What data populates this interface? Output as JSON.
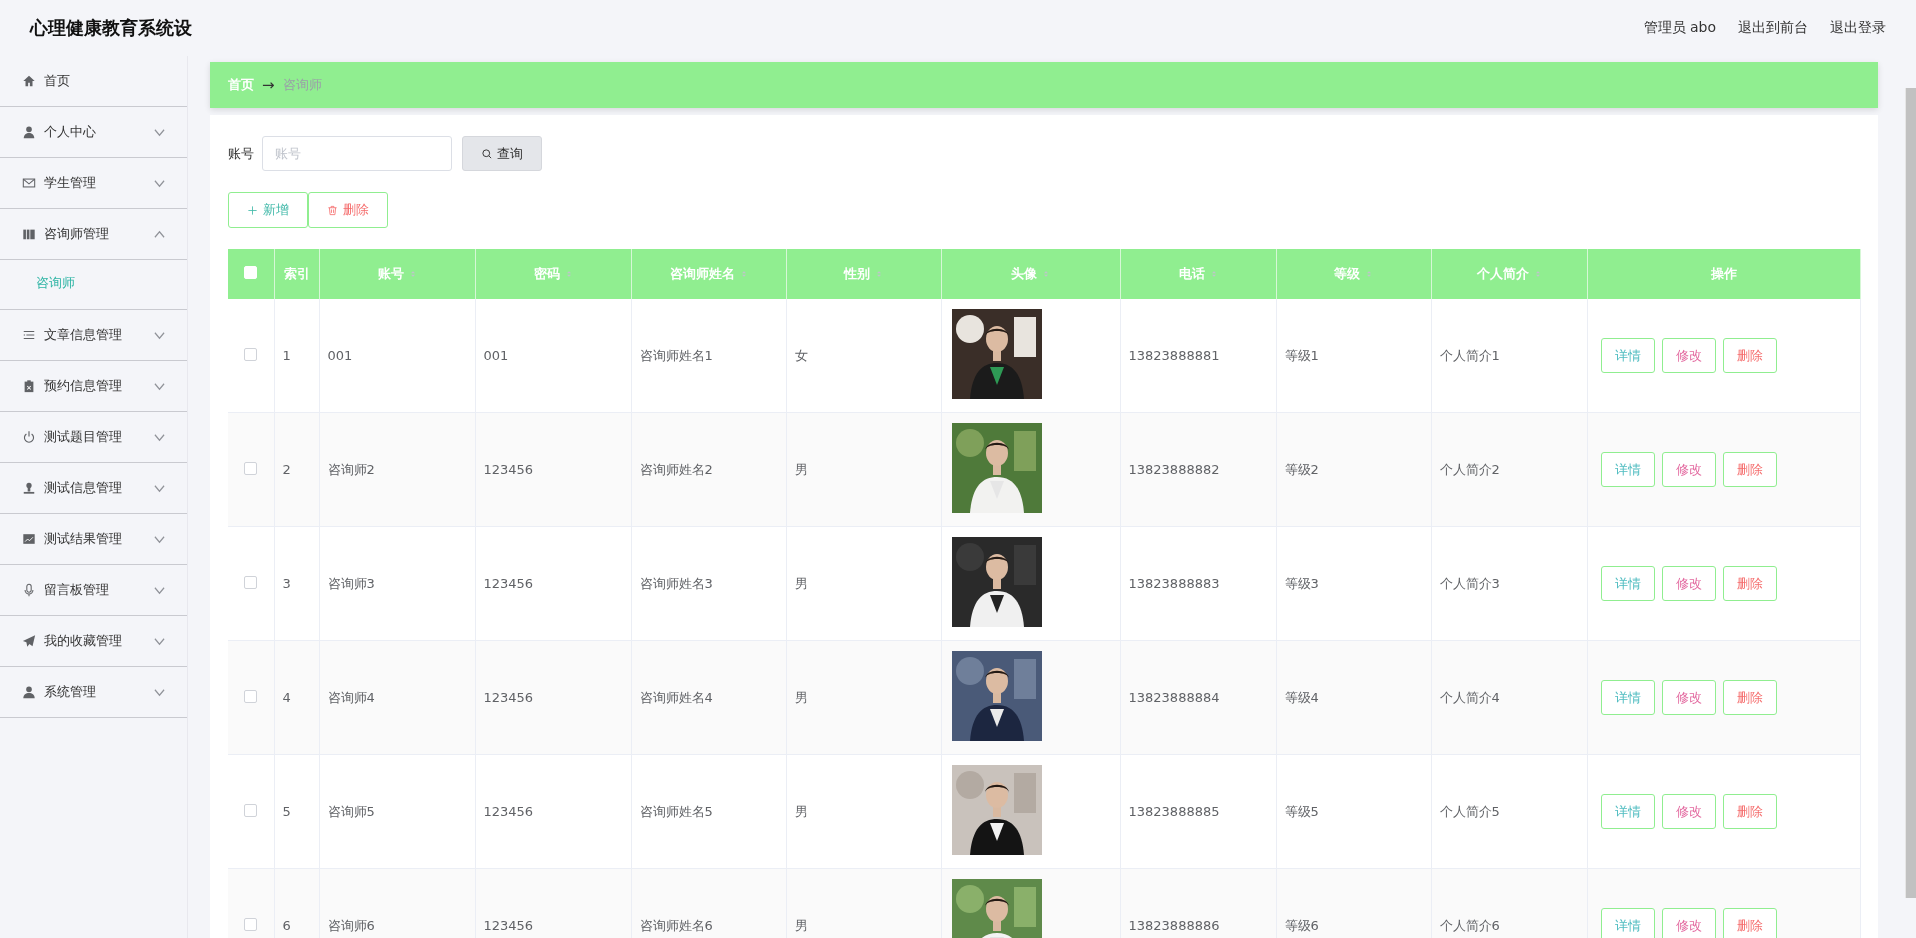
{
  "header": {
    "title": "心理健康教育系统设",
    "user": "管理员 abo",
    "links": [
      "退出到前台",
      "退出登录"
    ]
  },
  "sidebar": {
    "items": [
      {
        "label": "首页",
        "kind": "link"
      },
      {
        "label": "个人中心",
        "kind": "menu",
        "expanded": false
      },
      {
        "label": "学生管理",
        "kind": "menu",
        "expanded": false
      },
      {
        "label": "咨询师管理",
        "kind": "menu",
        "expanded": true,
        "children": [
          {
            "label": "咨询师",
            "selected": true
          }
        ]
      },
      {
        "label": "文章信息管理",
        "kind": "menu",
        "expanded": false
      },
      {
        "label": "预约信息管理",
        "kind": "menu",
        "expanded": false
      },
      {
        "label": "测试题目管理",
        "kind": "menu",
        "expanded": false
      },
      {
        "label": "测试信息管理",
        "kind": "menu",
        "expanded": false
      },
      {
        "label": "测试结果管理",
        "kind": "menu",
        "expanded": false
      },
      {
        "label": "留言板管理",
        "kind": "menu",
        "expanded": false
      },
      {
        "label": "我的收藏管理",
        "kind": "menu",
        "expanded": false
      },
      {
        "label": "系统管理",
        "kind": "menu",
        "expanded": false
      }
    ]
  },
  "breadcrumb": {
    "items": [
      "首页",
      "咨询师"
    ],
    "separator": "→"
  },
  "search": {
    "label": "账号",
    "placeholder": "账号",
    "button": "查询"
  },
  "actions": [
    {
      "label": "新增",
      "kind": "add"
    },
    {
      "label": "删除",
      "kind": "delete"
    }
  ],
  "table": {
    "all_checked": false,
    "columns": [
      {
        "label": "索引",
        "sortable": false
      },
      {
        "label": "账号",
        "sortable": true
      },
      {
        "label": "密码",
        "sortable": true
      },
      {
        "label": "咨询师姓名",
        "sortable": true
      },
      {
        "label": "性别",
        "sortable": true
      },
      {
        "label": "头像",
        "sortable": true
      },
      {
        "label": "电话",
        "sortable": true
      },
      {
        "label": "等级",
        "sortable": true
      },
      {
        "label": "个人简介",
        "sortable": true
      },
      {
        "label": "操作",
        "sortable": false
      }
    ],
    "rows": [
      {
        "checked": false,
        "cells": [
          "1",
          "001",
          "001",
          "咨询师姓名1",
          "女",
          {
            "kind": "picture"
          },
          "13823888881",
          "等级1",
          "个人简介1"
        ],
        "buttons": [
          "详情",
          "修改",
          "删除"
        ]
      },
      {
        "checked": false,
        "cells": [
          "2",
          "咨询师2",
          "123456",
          "咨询师姓名2",
          "男",
          {
            "kind": "picture"
          },
          "13823888882",
          "等级2",
          "个人简介2"
        ],
        "buttons": [
          "详情",
          "修改",
          "删除"
        ]
      },
      {
        "checked": false,
        "cells": [
          "3",
          "咨询师3",
          "123456",
          "咨询师姓名3",
          "男",
          {
            "kind": "picture"
          },
          "13823888883",
          "等级3",
          "个人简介3"
        ],
        "buttons": [
          "详情",
          "修改",
          "删除"
        ]
      },
      {
        "checked": false,
        "cells": [
          "4",
          "咨询师4",
          "123456",
          "咨询师姓名4",
          "男",
          {
            "kind": "picture"
          },
          "13823888884",
          "等级4",
          "个人简介4"
        ],
        "buttons": [
          "详情",
          "修改",
          "删除"
        ]
      },
      {
        "checked": false,
        "cells": [
          "5",
          "咨询师5",
          "123456",
          "咨询师姓名5",
          "男",
          {
            "kind": "picture"
          },
          "13823888885",
          "等级5",
          "个人简介5"
        ],
        "buttons": [
          "详情",
          "修改",
          "删除"
        ]
      },
      {
        "checked": false,
        "cells": [
          "6",
          "咨询师6",
          "123456",
          "咨询师姓名6",
          "男",
          {
            "kind": "picture"
          },
          "13823888886",
          "等级6",
          "个人简介6"
        ],
        "buttons": [
          "详情",
          "修改",
          "删除"
        ]
      }
    ]
  }
}
